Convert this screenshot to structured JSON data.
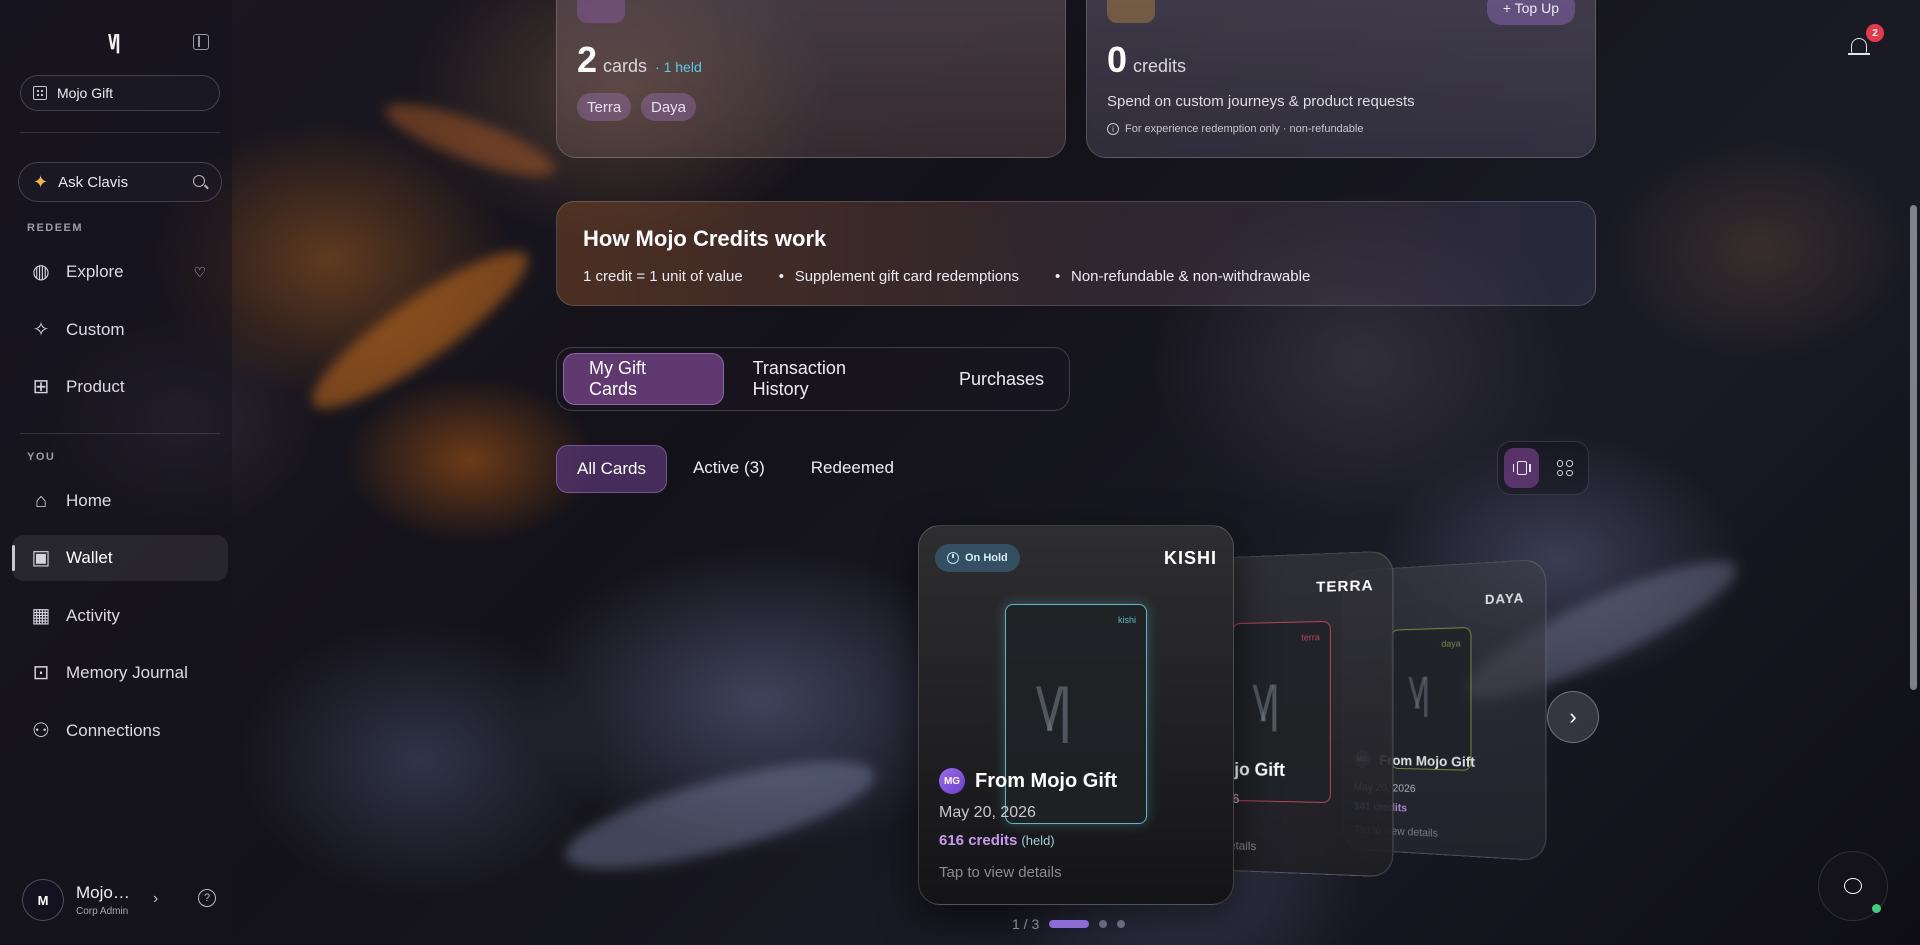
{
  "app": {
    "logo_text": "\\/|"
  },
  "sidebar": {
    "org_name": "Mojo Gift",
    "ask_label": "Ask Clavis",
    "section_redeem": "REDEEM",
    "section_you": "YOU",
    "redeem_items": [
      {
        "label": "Explore",
        "icon": "globe-icon"
      },
      {
        "label": "Custom",
        "icon": "sparkles-icon"
      },
      {
        "label": "Product",
        "icon": "gift-icon"
      }
    ],
    "you_items": [
      {
        "label": "Home",
        "icon": "home-icon"
      },
      {
        "label": "Wallet",
        "icon": "wallet-icon",
        "active": true
      },
      {
        "label": "Activity",
        "icon": "calendar-check-icon"
      },
      {
        "label": "Memory Journal",
        "icon": "book-open-icon"
      },
      {
        "label": "Connections",
        "icon": "users-icon"
      }
    ],
    "user": {
      "initial": "M",
      "name": "Mojo…",
      "role": "Corp Admin"
    }
  },
  "summary": {
    "cards_count": "2",
    "cards_unit": "cards",
    "cards_held": "· 1 held",
    "card_tags": [
      "Terra",
      "Daya"
    ],
    "credits_count": "0",
    "credits_unit": "credits",
    "credits_desc": "Spend on custom journeys & product requests",
    "credits_note": "For experience redemption only · non-refundable",
    "topup_label": "+ Top Up"
  },
  "how_it_works": {
    "title": "How Mojo Credits work",
    "points": [
      "1 credit = 1 unit of value",
      "Supplement gift card redemptions",
      "Non-refundable & non-withdrawable"
    ]
  },
  "tabs": [
    "My Gift Cards",
    "Transaction History",
    "Purchases"
  ],
  "filters": [
    "All Cards",
    "Active (3)",
    "Redeemed"
  ],
  "gift_cards": [
    {
      "brand": "KISHI",
      "inner_brand": "kishi",
      "status": "On Hold",
      "from": "From Mojo Gift",
      "badge": "MG",
      "date": "May 20, 2026",
      "credits": "616 credits",
      "credits_note": "(held)",
      "cta": "Tap to view details",
      "accent": "#5fb8c8"
    },
    {
      "brand": "TERRA",
      "inner_brand": "terra",
      "from": "n Mojo Gift",
      "date": "6",
      "cta": "details",
      "accent": "#c0405a"
    },
    {
      "brand": "DAYA",
      "inner_brand": "daya",
      "from": "From Mojo Gift",
      "date": "May 20, 2026",
      "credits": "141 credits",
      "cta": "Tap to view details",
      "accent": "#8a9a40"
    }
  ],
  "pager": {
    "text": "1 / 3"
  },
  "notifications": {
    "count": "2"
  },
  "colors": {
    "accent_purple": "#8c6ad8",
    "held_blue": "#5ec8e6",
    "badge_red": "#e33a4e",
    "online_green": "#3bd07a"
  }
}
